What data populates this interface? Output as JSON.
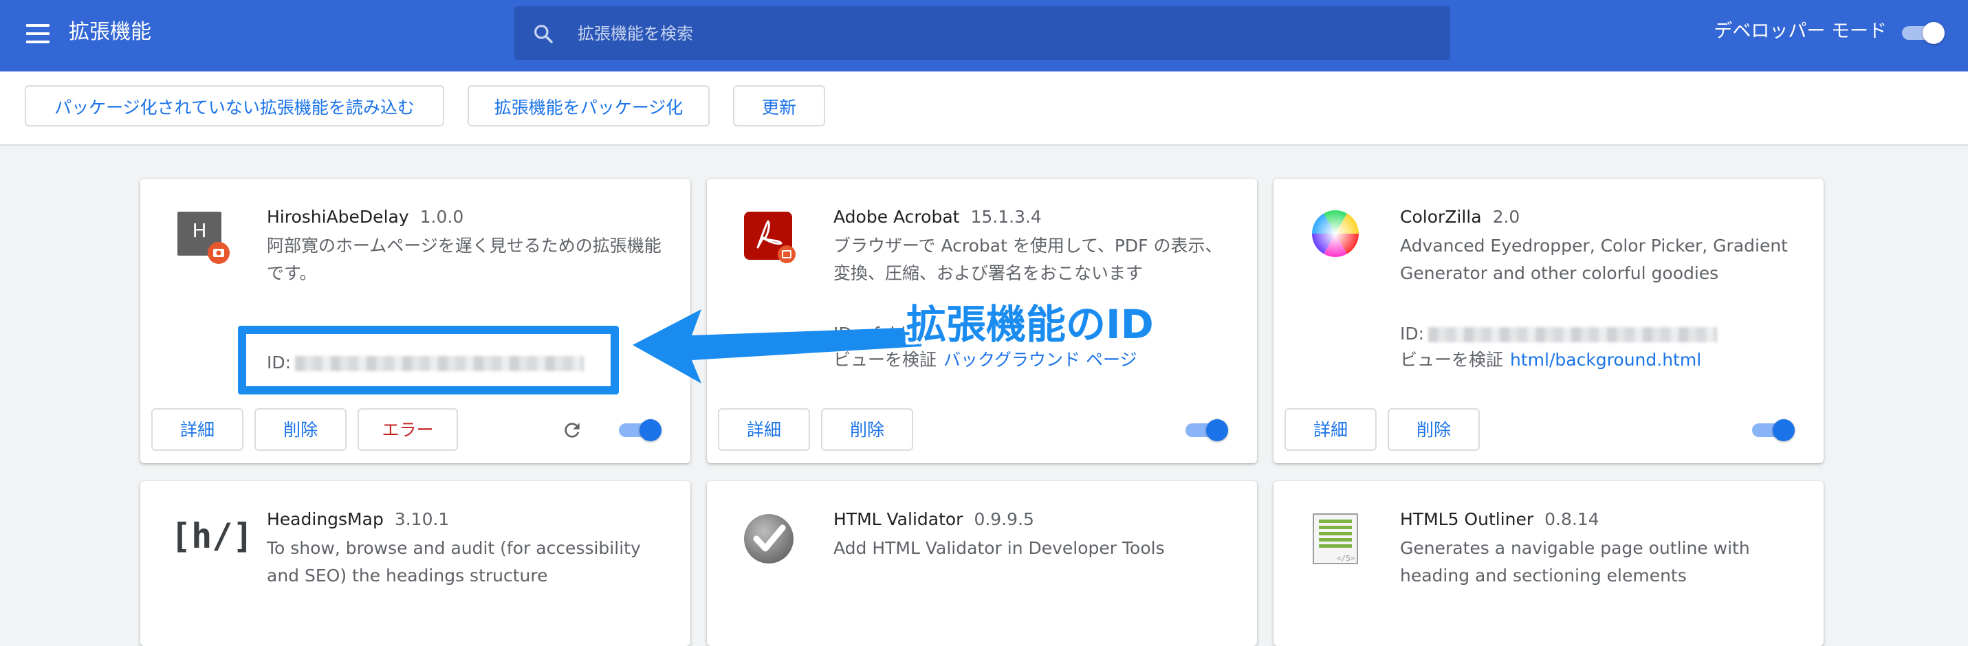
{
  "header": {
    "title": "拡張機能",
    "search_placeholder": "拡張機能を検索",
    "dev_mode_label": "デベロッパー モード",
    "dev_mode_on": true
  },
  "toolbar": {
    "load_unpacked": "パッケージ化されていない拡張機能を読み込む",
    "pack_extension": "拡張機能をパッケージ化",
    "update": "更新"
  },
  "extensions": [
    {
      "name": "HiroshiAbeDelay",
      "version": "1.0.0",
      "description": "阿部寛のホームページを遅く見せるための拡張機能です。",
      "id_label": "ID:",
      "buttons": {
        "details": "詳細",
        "remove": "削除",
        "errors": "エラー"
      },
      "enabled": true,
      "icon_letter": "H"
    },
    {
      "name": "Adobe Acrobat",
      "version": "15.1.3.4",
      "description": "ブラウザーで Acrobat を使用して、PDF の表示、変換、圧縮、および署名をおこないます",
      "id_label": "ID: efaidn",
      "inspect_label": "ビューを検証",
      "inspect_link": "バックグラウンド ページ",
      "buttons": {
        "details": "詳細",
        "remove": "削除"
      },
      "enabled": true
    },
    {
      "name": "ColorZilla",
      "version": "2.0",
      "description": "Advanced Eyedropper, Color Picker, Gradient Generator and other colorful goodies",
      "id_label": "ID:",
      "inspect_label": "ビューを検証",
      "inspect_link": "html/background.html",
      "buttons": {
        "details": "詳細",
        "remove": "削除"
      },
      "enabled": true
    },
    {
      "name": "HeadingsMap",
      "version": "3.10.1",
      "description": "To show, browse and audit (for accessibility and SEO) the headings structure",
      "icon_text": "[h/]"
    },
    {
      "name": "HTML Validator",
      "version": "0.9.9.5",
      "description": "Add HTML Validator in Developer Tools"
    },
    {
      "name": "HTML5 Outliner",
      "version": "0.8.14",
      "description": "Generates a navigable page outline with heading and sectioning elements",
      "icon_text": "</5>"
    }
  ],
  "annotation": {
    "label": "拡張機能のID",
    "color": "#1a8cf0"
  },
  "colors": {
    "header_bg": "#3367d6",
    "accent": "#1a73e8",
    "error": "#c5221f"
  }
}
